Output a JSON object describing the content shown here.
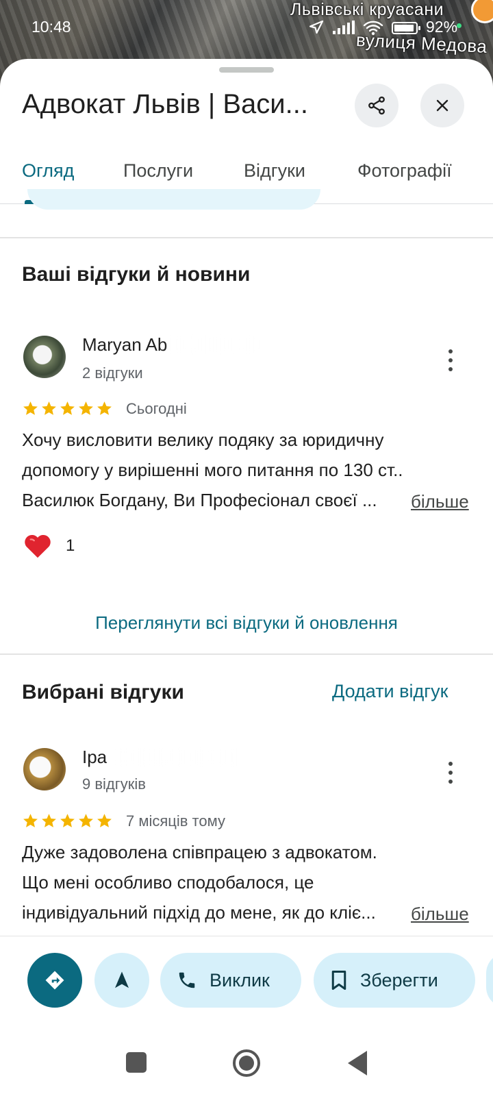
{
  "status_bar": {
    "time": "10:48",
    "battery": "92%"
  },
  "map": {
    "label_top": "Львівські круасани",
    "label_street": "вулиця Медова"
  },
  "header": {
    "title": "Адвокат Львів | Васи..."
  },
  "tabs": [
    {
      "label": "Огляд",
      "active": true
    },
    {
      "label": "Послуги",
      "active": false
    },
    {
      "label": "Відгуки",
      "active": false
    },
    {
      "label": "Фотографії",
      "active": false
    }
  ],
  "your_reviews": {
    "title": "Ваші відгуки й новини",
    "review": {
      "name": "Maryan Ab",
      "count": "2 відгуки",
      "rating": 5,
      "date": "Сьогодні",
      "lines": [
        "Хочу висловити велику подяку за юридичну",
        "допомогу у вирішенні мого питання по 130 ст..",
        "Василюк Богдану, Ви Професіонал своєї ..."
      ],
      "more": "більше",
      "reaction_count": "1"
    },
    "see_all": "Переглянути всі відгуки й оновлення"
  },
  "selected_reviews": {
    "title": "Вибрані відгуки",
    "add_review": "Додати відгук",
    "review": {
      "name": "Іра",
      "count": "9 відгуків",
      "rating": 5,
      "date": "7 місяців тому",
      "lines": [
        "Дуже задоволена співпрацею з адвокатом.",
        "Що мені особливо сподобалося, це",
        "індивідуальний підхід до мене, як до кліє..."
      ],
      "more": "більше"
    }
  },
  "actions": {
    "call": "Виклик",
    "save": "Зберегти"
  },
  "colors": {
    "accent": "#0b6a80",
    "chip": "#d6f0fa",
    "star": "#f4b400",
    "heart": "#e0242f"
  }
}
